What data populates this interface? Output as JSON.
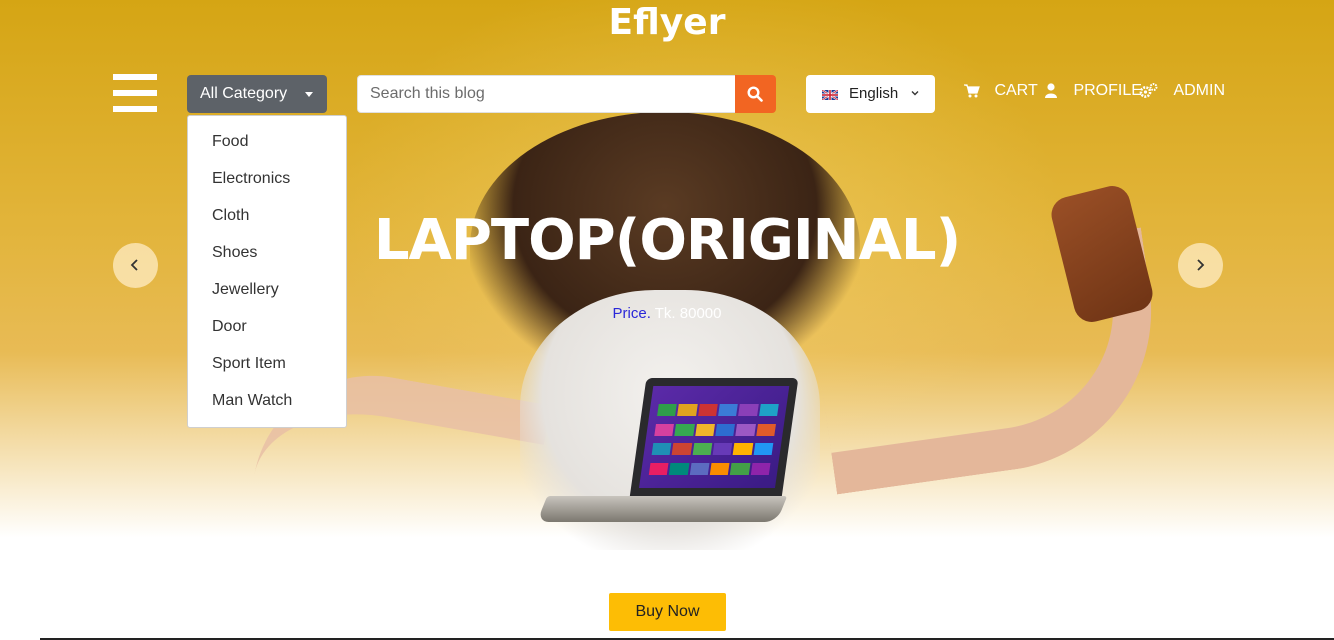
{
  "brand": {
    "name": "Eflyer"
  },
  "header": {
    "menu_icon": "hamburger-icon",
    "category": {
      "label": "All Category",
      "items": [
        "Food",
        "Electronics",
        "Cloth",
        "Shoes",
        "Jewellery",
        "Door",
        "Sport Item",
        "Man Watch"
      ]
    },
    "search": {
      "placeholder": "Search this blog",
      "value": "",
      "icon": "search-icon",
      "button_color": "#f26522"
    },
    "language": {
      "label": "English",
      "flag_icon": "uk-flag-icon",
      "chevron_icon": "chevron-down-icon"
    },
    "nav": [
      {
        "label": "CART",
        "icon": "cart-icon"
      },
      {
        "label": "PROFILE",
        "icon": "user-icon"
      },
      {
        "label": "ADMIN",
        "icon": "gears-icon"
      }
    ]
  },
  "slide": {
    "title": "LAPTOP(ORIGINAL)",
    "price_label": "Price.",
    "price_value": "Tk. 80000",
    "prev_icon": "chevron-left-icon",
    "next_icon": "chevron-right-icon"
  },
  "cta": {
    "label": "Buy Now",
    "color": "#fdbd05"
  },
  "colors": {
    "accent": "#f26522",
    "hero_bg": "#e2b43a",
    "category_button": "#5d6268",
    "price_label": "#2a27d8"
  }
}
